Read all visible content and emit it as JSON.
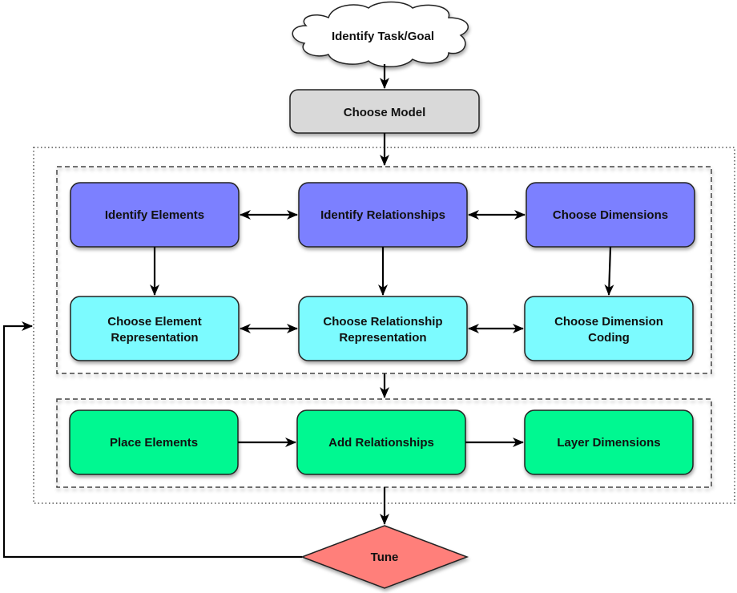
{
  "diagram": {
    "start": {
      "label": "Identify Task/Goal",
      "shape": "cloud",
      "color": "#ffffff"
    },
    "model": {
      "label": "Choose Model",
      "color": "#d9d9d9"
    },
    "row1": [
      {
        "label": "Identify Elements",
        "color": "#7b80ff"
      },
      {
        "label": "Identify Relationships",
        "color": "#7b80ff"
      },
      {
        "label": "Choose Dimensions",
        "color": "#7b80ff"
      }
    ],
    "row2": [
      {
        "line1": "Choose Element",
        "line2": "Representation",
        "color": "#7bfbff"
      },
      {
        "line1": "Choose Relationship",
        "line2": "Representation",
        "color": "#7bfbff"
      },
      {
        "line1": "Choose Dimension",
        "line2": "Coding",
        "color": "#7bfbff"
      }
    ],
    "row3": [
      {
        "label": "Place Elements",
        "color": "#00f891"
      },
      {
        "label": "Add Relationships",
        "color": "#00f891"
      },
      {
        "label": "Layer Dimensions",
        "color": "#00f891"
      }
    ],
    "decision": {
      "label": "Tune",
      "shape": "diamond",
      "color": "#ff7f7a"
    },
    "edges": [
      {
        "from": "Identify Task/Goal",
        "to": "Choose Model",
        "type": "directed"
      },
      {
        "from": "Choose Model",
        "to": "design-group",
        "type": "directed"
      },
      {
        "from": "Identify Elements",
        "to": "Identify Relationships",
        "type": "bidirectional"
      },
      {
        "from": "Identify Relationships",
        "to": "Choose Dimensions",
        "type": "bidirectional"
      },
      {
        "from": "Identify Elements",
        "to": "Choose Element Representation",
        "type": "directed"
      },
      {
        "from": "Identify Relationships",
        "to": "Choose Relationship Representation",
        "type": "directed"
      },
      {
        "from": "Choose Dimensions",
        "to": "Choose Dimension Coding",
        "type": "directed"
      },
      {
        "from": "Choose Element Representation",
        "to": "Choose Relationship Representation",
        "type": "bidirectional"
      },
      {
        "from": "Choose Relationship Representation",
        "to": "Choose Dimension Coding",
        "type": "bidirectional"
      },
      {
        "from": "representation-group",
        "to": "layout-group",
        "type": "directed"
      },
      {
        "from": "Place Elements",
        "to": "Add Relationships",
        "type": "directed"
      },
      {
        "from": "Add Relationships",
        "to": "Layer Dimensions",
        "type": "directed"
      },
      {
        "from": "process-group",
        "to": "Tune",
        "type": "directed"
      },
      {
        "from": "Tune",
        "to": "process-group",
        "type": "feedback"
      }
    ]
  }
}
